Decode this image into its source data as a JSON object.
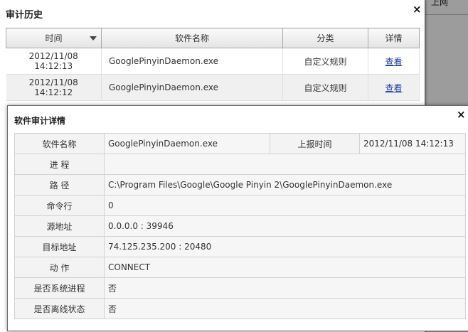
{
  "background": {
    "fragment_text": "上网"
  },
  "history_dialog": {
    "title": "审计历史",
    "close_glyph": "×",
    "columns": [
      "时间",
      "软件名称",
      "分类",
      "详情"
    ],
    "rows": [
      {
        "time": "2012/11/08 14:12:13",
        "name": "GooglePinyinDaemon.exe",
        "category": "自定义规则",
        "detail": "查看"
      },
      {
        "time": "2012/11/08 14:12:12",
        "name": "GooglePinyinDaemon.exe",
        "category": "自定义规则",
        "detail": "查看"
      }
    ]
  },
  "detail_dialog": {
    "title": "软件审计详情",
    "close_glyph": "×",
    "software_name_label": "软件名称",
    "software_name": "GooglePinyinDaemon.exe",
    "report_time_label": "上报时间",
    "report_time": "2012/11/08 14:12:13",
    "fields": [
      {
        "label": "进 程",
        "value": ""
      },
      {
        "label": "路 径",
        "value": "C:\\Program Files\\Google\\Google Pinyin 2\\GooglePinyinDaemon.exe"
      },
      {
        "label": "命令行",
        "value": "0"
      },
      {
        "label": "源地址",
        "value": "0.0.0.0 : 39946"
      },
      {
        "label": "目标地址",
        "value": "74.125.235.200 : 20480"
      },
      {
        "label": "动 作",
        "value": "CONNECT"
      },
      {
        "label": "是否系统进程",
        "value": "否"
      },
      {
        "label": "是否离线状态",
        "value": "否"
      }
    ]
  }
}
